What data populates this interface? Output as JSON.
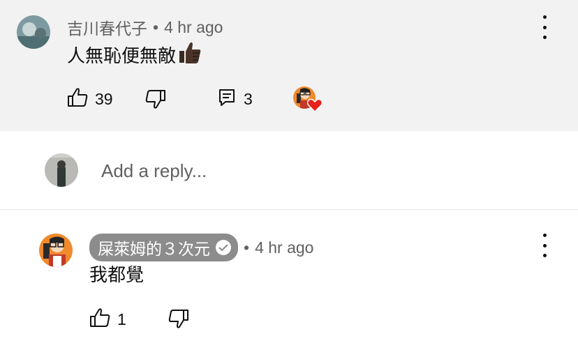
{
  "top_comment": {
    "author": "吉川春代子",
    "time": "4 hr ago",
    "separator": "•",
    "text": "人無恥便無敵",
    "emoji": "thumbs-up-emoji",
    "likes": "39",
    "replies": "3",
    "creator_heart": true,
    "icons": {
      "like": "thumb-up-icon",
      "dislike": "thumb-down-icon",
      "reply": "reply-icon",
      "menu": "more-vert-icon"
    }
  },
  "reply_box": {
    "placeholder": "Add a reply..."
  },
  "reply_comment": {
    "author": "屎萊姆的３次元",
    "verified": true,
    "time": "4 hr ago",
    "separator": "•",
    "text": "我都覺",
    "likes": "1"
  },
  "colors": {
    "background_top": "#f2f2f2",
    "heart": "#e62117",
    "badge": "#8c8c8c",
    "avatar_orange": "#f08a2c"
  }
}
